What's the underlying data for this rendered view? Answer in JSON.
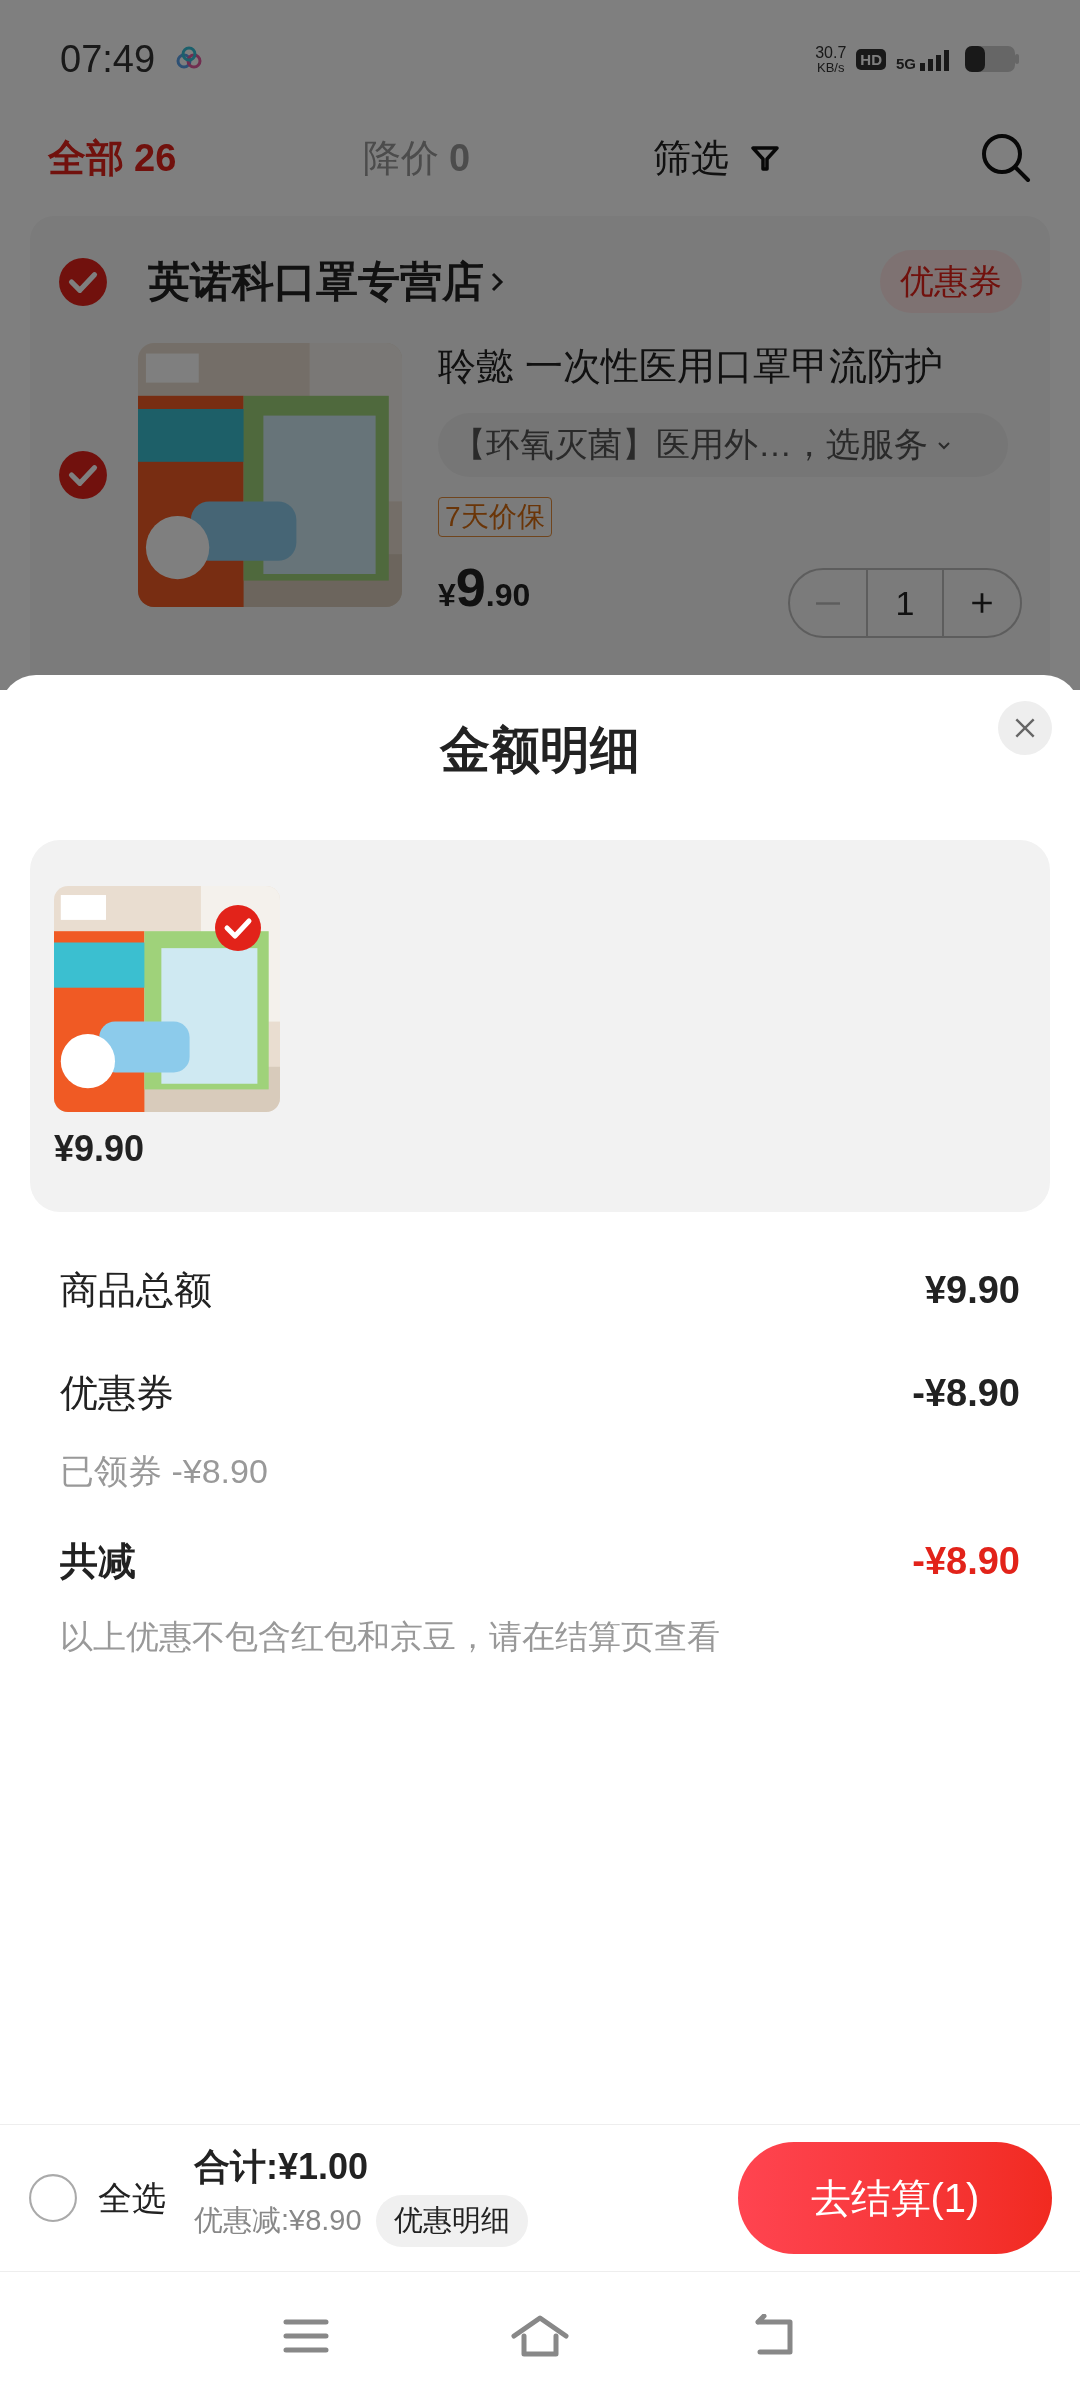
{
  "status_bar": {
    "time": "07:49",
    "net_speed": "30.7",
    "net_unit": "KB/s",
    "hd": "HD",
    "network": "5G"
  },
  "tabs": [
    {
      "label": "全部",
      "count": "26",
      "selected": true
    },
    {
      "label": "降价",
      "count": "0",
      "selected": false
    }
  ],
  "filter": {
    "label": "筛选"
  },
  "store": {
    "checked": true,
    "name": "英诺科口罩专营店",
    "coupon": "优惠券"
  },
  "item": {
    "checked": true,
    "title": "聆懿 一次性医用口罩甲流防护",
    "spec": "【环氧灭菌】医用外…，选服务",
    "badge": "7天价保",
    "currency": "¥",
    "price_int": "9",
    "price_dec": ".90",
    "quantity": "1"
  },
  "sheet": {
    "title": "金额明细",
    "products": [
      {
        "price": "¥9.90",
        "selected": true
      }
    ],
    "rows": [
      {
        "kind": "normal",
        "label": "商品总额",
        "amount": "¥9.90"
      },
      {
        "kind": "normal",
        "label": "优惠券",
        "amount": "-¥8.90",
        "sub": "已领券 -¥8.90"
      },
      {
        "kind": "total",
        "label": "共减",
        "amount": "-¥8.90"
      }
    ],
    "note": "以上优惠不包含红包和京豆，请在结算页查看"
  },
  "bottom_bar": {
    "select_all": {
      "label": "全选",
      "checked": false
    },
    "total": "合计:¥1.00",
    "discount": "优惠减:¥8.90",
    "details": "优惠明细",
    "checkout": "去结算(1)"
  }
}
